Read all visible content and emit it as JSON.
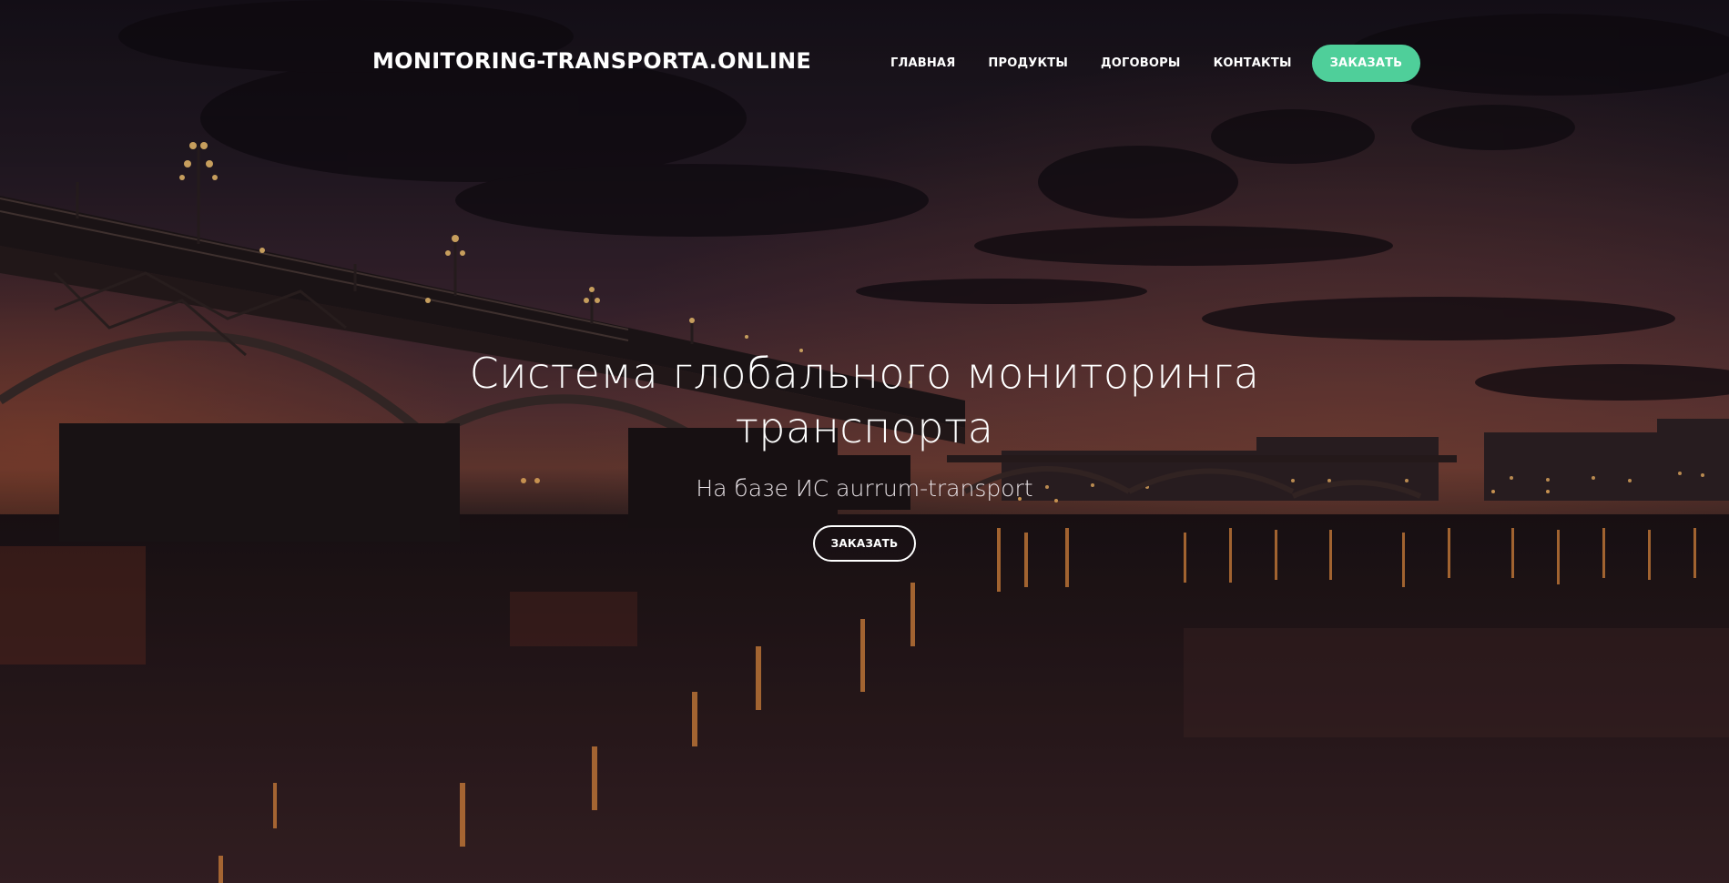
{
  "header": {
    "logo_text": "MONITORING-TRANSPORTA.ONLINE",
    "nav": [
      {
        "label": "ГЛАВНАЯ"
      },
      {
        "label": "ПРОДУКТЫ"
      },
      {
        "label": "ДОГОВОРЫ"
      },
      {
        "label": "КОНТАКТЫ"
      }
    ],
    "cta_label": "ЗАКАЗАТЬ"
  },
  "hero": {
    "title": "Система глобального мониторинга транспорта",
    "subtitle": "На базе ИС aurrum-transport",
    "cta_label": "ЗАКАЗАТЬ"
  },
  "colors": {
    "accent": "#4fcf9a",
    "text": "#ffffff"
  }
}
